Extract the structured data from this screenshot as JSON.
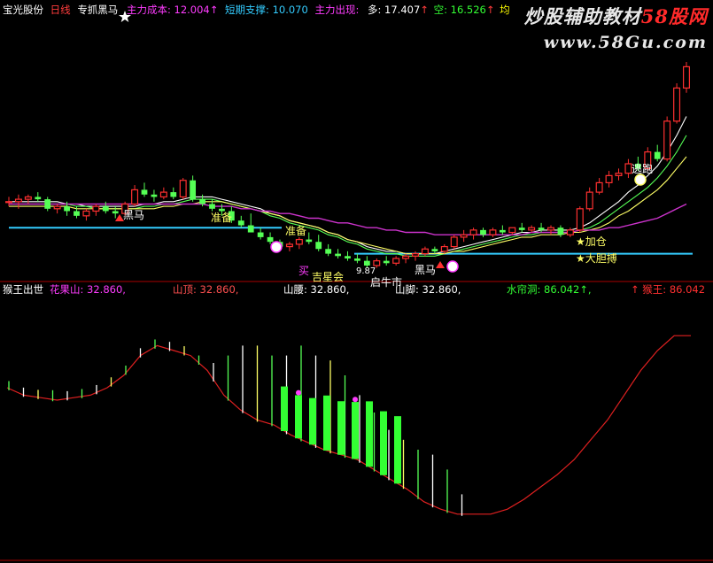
{
  "top_panel": {
    "stock_name": "宝光股份",
    "period": "日线",
    "indicator_name": "专抓黑马",
    "metrics": [
      {
        "label": "主力成本:",
        "value": "12.004",
        "arrow": "↑",
        "color": "#ff3cff"
      },
      {
        "label": "短期支撑:",
        "value": "10.070",
        "arrow": "",
        "color": "#33ccff"
      },
      {
        "label": "主力出现:",
        "value": "",
        "arrow": "",
        "color": "#ff3cff"
      },
      {
        "label": "多:",
        "value": "17.407",
        "arrow": "↑",
        "color": "#ffffff"
      },
      {
        "label": "空:",
        "value": "16.526",
        "arrow": "↑",
        "color": "#33ff33"
      },
      {
        "label": "均",
        "value": "",
        "arrow": "",
        "color": "#ffff00"
      }
    ],
    "annotations": {
      "heima_1": "黑马",
      "zhunbei_1": "准备",
      "zhunbei_2": "准备",
      "mai": "买",
      "jixing": "吉星会",
      "price_note": "9.87",
      "xiaosheng": "启牛市",
      "heima_2": "黑马",
      "taopao": "逃跑",
      "jiacang": "★加仓",
      "dadan": "★大胆搏"
    }
  },
  "watermark": {
    "line1_white": "炒股辅助教材",
    "line1_red": "58股网",
    "line2": "www.58Gu.com"
  },
  "bottom_panel": {
    "indicator_name": "猴王出世",
    "metrics": [
      {
        "label": "花果山:",
        "value": "32.860,",
        "color": "#ff3cff"
      },
      {
        "label": "山顶:",
        "value": "32.860,",
        "color": "#ff5050"
      },
      {
        "label": "山腰:",
        "value": "32.860,",
        "color": "#ffffff"
      },
      {
        "label": "山脚:",
        "value": "32.860,",
        "color": "#ffffff"
      },
      {
        "label": "水帘洞:",
        "value": "86.042",
        "arrow": "↑,",
        "color": "#33ff33"
      },
      {
        "label": "↑ 猴王:",
        "value": "86.042",
        "color": "#ff3030"
      }
    ]
  },
  "chart_data": [
    {
      "type": "candlestick",
      "panel": "main",
      "up_color": "#ff3030",
      "down_color": "#55ff55",
      "ohlc": [
        [
          11.6,
          11.8,
          11.4,
          11.6
        ],
        [
          11.6,
          11.9,
          11.3,
          11.7
        ],
        [
          11.7,
          11.9,
          11.5,
          11.8
        ],
        [
          11.8,
          12.0,
          11.6,
          11.7
        ],
        [
          11.7,
          11.8,
          11.2,
          11.3
        ],
        [
          11.3,
          11.5,
          11.1,
          11.4
        ],
        [
          11.4,
          11.6,
          11.0,
          11.2
        ],
        [
          11.2,
          11.4,
          10.9,
          11.0
        ],
        [
          11.0,
          11.3,
          10.8,
          11.2
        ],
        [
          11.2,
          11.5,
          11.0,
          11.4
        ],
        [
          11.4,
          11.6,
          11.1,
          11.2
        ],
        [
          11.2,
          11.4,
          10.9,
          11.1
        ],
        [
          11.1,
          11.6,
          11.0,
          11.5
        ],
        [
          11.5,
          12.3,
          11.4,
          12.1
        ],
        [
          12.1,
          12.4,
          11.8,
          11.9
        ],
        [
          11.9,
          12.1,
          11.6,
          11.8
        ],
        [
          11.8,
          12.2,
          11.7,
          12.0
        ],
        [
          12.0,
          12.2,
          11.7,
          11.8
        ],
        [
          11.8,
          12.6,
          11.7,
          12.5
        ],
        [
          12.5,
          12.7,
          11.6,
          11.7
        ],
        [
          11.7,
          11.9,
          11.4,
          11.5
        ],
        [
          11.5,
          11.7,
          11.2,
          11.3
        ],
        [
          11.3,
          11.5,
          11.0,
          11.2
        ],
        [
          11.2,
          11.4,
          10.7,
          10.8
        ],
        [
          10.8,
          11.0,
          10.5,
          10.6
        ],
        [
          10.6,
          11.1,
          10.4,
          10.3
        ],
        [
          10.3,
          10.5,
          10.0,
          10.1
        ],
        [
          10.1,
          10.3,
          9.8,
          9.9
        ],
        [
          9.9,
          10.0,
          9.6,
          9.7
        ],
        [
          9.7,
          9.9,
          9.5,
          9.8
        ],
        [
          9.8,
          10.1,
          9.6,
          10.0
        ],
        [
          10.0,
          10.3,
          9.8,
          9.9
        ],
        [
          9.9,
          10.2,
          9.5,
          9.6
        ],
        [
          9.6,
          9.8,
          9.3,
          9.4
        ],
        [
          9.4,
          9.6,
          9.2,
          9.3
        ],
        [
          9.3,
          9.5,
          9.1,
          9.2
        ],
        [
          9.2,
          9.4,
          9.0,
          9.1
        ],
        [
          9.1,
          9.3,
          8.8,
          8.9
        ],
        [
          8.9,
          9.2,
          8.8,
          9.1
        ],
        [
          9.1,
          9.3,
          8.9,
          9.0
        ],
        [
          9.0,
          9.3,
          8.9,
          9.2
        ],
        [
          9.2,
          9.4,
          9.0,
          9.3
        ],
        [
          9.3,
          9.5,
          9.1,
          9.4
        ],
        [
          9.4,
          9.7,
          9.3,
          9.6
        ],
        [
          9.6,
          9.7,
          9.4,
          9.5
        ],
        [
          9.5,
          9.8,
          9.4,
          9.7
        ],
        [
          9.7,
          10.2,
          9.6,
          10.1
        ],
        [
          10.1,
          10.4,
          9.9,
          10.2
        ],
        [
          10.2,
          10.5,
          10.0,
          10.4
        ],
        [
          10.4,
          10.5,
          10.1,
          10.2
        ],
        [
          10.2,
          10.5,
          10.1,
          10.4
        ],
        [
          10.4,
          10.6,
          10.2,
          10.3
        ],
        [
          10.3,
          10.5,
          10.2,
          10.5
        ],
        [
          10.5,
          10.7,
          10.3,
          10.4
        ],
        [
          10.4,
          10.6,
          10.3,
          10.5
        ],
        [
          10.5,
          10.7,
          10.3,
          10.4
        ],
        [
          10.4,
          10.6,
          10.2,
          10.5
        ],
        [
          10.5,
          10.6,
          10.1,
          10.2
        ],
        [
          10.2,
          10.5,
          10.1,
          10.4
        ],
        [
          10.4,
          11.4,
          10.3,
          11.3
        ],
        [
          11.3,
          12.2,
          11.2,
          12.0
        ],
        [
          12.0,
          12.6,
          11.9,
          12.4
        ],
        [
          12.4,
          12.9,
          12.2,
          12.7
        ],
        [
          12.7,
          13.0,
          12.5,
          12.8
        ],
        [
          12.8,
          13.4,
          12.6,
          13.2
        ],
        [
          13.2,
          13.5,
          12.9,
          13.0
        ],
        [
          13.0,
          13.9,
          12.9,
          13.7
        ],
        [
          13.7,
          14.0,
          13.3,
          13.4
        ],
        [
          13.4,
          15.2,
          13.3,
          15.0
        ],
        [
          15.0,
          16.6,
          14.9,
          16.4
        ],
        [
          16.4,
          17.5,
          16.2,
          17.3
        ]
      ],
      "lines": [
        {
          "name": "多",
          "color": "#ffffff",
          "values": [
            11.6,
            11.6,
            11.6,
            11.6,
            11.6,
            11.6,
            11.5,
            11.5,
            11.4,
            11.4,
            11.4,
            11.4,
            11.4,
            11.4,
            11.5,
            11.5,
            11.6,
            11.6,
            11.7,
            11.8,
            11.8,
            11.8,
            11.7,
            11.6,
            11.5,
            11.4,
            11.3,
            11.1,
            11.0,
            10.8,
            10.7,
            10.6,
            10.5,
            10.3,
            10.2,
            10.0,
            9.9,
            9.7,
            9.6,
            9.5,
            9.5,
            9.4,
            9.4,
            9.4,
            9.4,
            9.5,
            9.6,
            9.7,
            9.8,
            9.9,
            10.0,
            10.1,
            10.2,
            10.3,
            10.3,
            10.4,
            10.4,
            10.4,
            10.4,
            10.5,
            10.7,
            11.0,
            11.3,
            11.6,
            12.0,
            12.3,
            12.7,
            13.1,
            13.7,
            14.4,
            15.2
          ]
        },
        {
          "name": "空",
          "color": "#55ff55",
          "values": [
            11.5,
            11.5,
            11.5,
            11.5,
            11.5,
            11.5,
            11.5,
            11.4,
            11.4,
            11.3,
            11.3,
            11.3,
            11.3,
            11.3,
            11.4,
            11.4,
            11.5,
            11.5,
            11.6,
            11.7,
            11.7,
            11.7,
            11.6,
            11.5,
            11.4,
            11.3,
            11.2,
            11.0,
            10.9,
            10.7,
            10.6,
            10.5,
            10.4,
            10.2,
            10.1,
            9.9,
            9.8,
            9.6,
            9.5,
            9.4,
            9.4,
            9.3,
            9.3,
            9.3,
            9.3,
            9.4,
            9.5,
            9.6,
            9.7,
            9.8,
            9.9,
            10.0,
            10.1,
            10.2,
            10.2,
            10.3,
            10.3,
            10.3,
            10.3,
            10.4,
            10.5,
            10.7,
            11.0,
            11.3,
            11.6,
            11.9,
            12.2,
            12.6,
            13.1,
            13.7,
            14.4
          ]
        },
        {
          "name": "中期",
          "color": "#ffff66",
          "values": [
            11.4,
            11.4,
            11.4,
            11.4,
            11.4,
            11.4,
            11.4,
            11.3,
            11.3,
            11.3,
            11.3,
            11.3,
            11.3,
            11.3,
            11.3,
            11.3,
            11.4,
            11.4,
            11.5,
            11.5,
            11.6,
            11.6,
            11.6,
            11.5,
            11.4,
            11.3,
            11.2,
            11.1,
            11.0,
            10.8,
            10.7,
            10.6,
            10.5,
            10.3,
            10.2,
            10.0,
            9.9,
            9.8,
            9.7,
            9.6,
            9.5,
            9.4,
            9.4,
            9.4,
            9.4,
            9.4,
            9.5,
            9.5,
            9.6,
            9.7,
            9.8,
            9.9,
            10.0,
            10.1,
            10.1,
            10.2,
            10.2,
            10.2,
            10.3,
            10.3,
            10.4,
            10.5,
            10.7,
            11.0,
            11.2,
            11.5,
            11.8,
            12.1,
            12.5,
            13.0,
            13.5
          ]
        },
        {
          "name": "主力成本",
          "color": "#cc33cc",
          "values": [
            11.5,
            11.5,
            11.5,
            11.5,
            11.5,
            11.5,
            11.5,
            11.5,
            11.5,
            11.5,
            11.5,
            11.5,
            11.5,
            11.5,
            11.5,
            11.5,
            11.5,
            11.5,
            11.5,
            11.5,
            11.5,
            11.4,
            11.4,
            11.4,
            11.3,
            11.3,
            11.2,
            11.2,
            11.1,
            11.1,
            11.0,
            10.9,
            10.9,
            10.8,
            10.7,
            10.7,
            10.6,
            10.5,
            10.5,
            10.4,
            10.4,
            10.3,
            10.3,
            10.3,
            10.2,
            10.2,
            10.2,
            10.2,
            10.2,
            10.2,
            10.2,
            10.2,
            10.2,
            10.2,
            10.3,
            10.3,
            10.3,
            10.3,
            10.3,
            10.4,
            10.4,
            10.4,
            10.5,
            10.5,
            10.6,
            10.7,
            10.8,
            10.9,
            11.1,
            11.3,
            11.5
          ]
        }
      ],
      "support_lines": [
        {
          "name": "短期支撑-1",
          "color": "#33ccff",
          "value": 10.5
        },
        {
          "name": "短期支撑-2",
          "color": "#33ccff",
          "value": 9.4
        }
      ]
    },
    {
      "type": "bar",
      "panel": "sub",
      "red_line": [
        65,
        62,
        61,
        60,
        61,
        62,
        65,
        70,
        78,
        82,
        80,
        78,
        72,
        62,
        56,
        52,
        50,
        46,
        43,
        40,
        38,
        36,
        32,
        28,
        24,
        19,
        16,
        14,
        14,
        14,
        16,
        20,
        25,
        30,
        36,
        44,
        52,
        62,
        72,
        80,
        86,
        86
      ],
      "vertical_bars": [
        62,
        60,
        62,
        64,
        62,
        60,
        50,
        44,
        38,
        45,
        50,
        58,
        62,
        66,
        75,
        78,
        82,
        82,
        78,
        78,
        82,
        78,
        76,
        70,
        62,
        55,
        48,
        44,
        40,
        38,
        32,
        22
      ]
    }
  ]
}
